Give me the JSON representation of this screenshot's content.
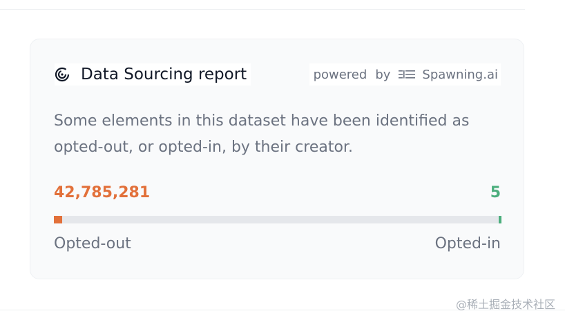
{
  "card": {
    "title": "Data Sourcing report",
    "title_icon": "target-swirl-icon",
    "powered_label": "powered",
    "powered_by": "by",
    "provider_icon": "spawning-logo-icon",
    "provider_name": "Spawning.ai",
    "description": "Some elements in this dataset have been identified as opted-out, or opted-in, by their creator."
  },
  "stats": {
    "opted_out_count": "42,785,281",
    "opted_in_count": "5",
    "opted_out_label": "Opted-out",
    "opted_in_label": "Opted-in",
    "opted_out_fraction": 0.018,
    "opted_in_fraction": 0.006
  },
  "colors": {
    "opted_out": "#e2703a",
    "opted_in": "#4cae7d",
    "track": "#e5e7eb",
    "text_muted": "#6b7280",
    "text_strong": "#111827"
  },
  "watermark": "@稀土掘金技术社区"
}
